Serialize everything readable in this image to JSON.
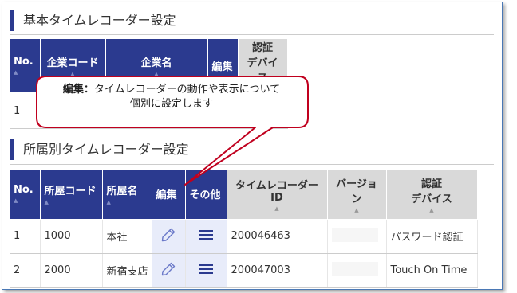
{
  "basic": {
    "title": "基本タイムレコーダー設定",
    "headers": {
      "no": "No.",
      "company_code": "企業コード",
      "company_name": "企業名",
      "edit": "編集",
      "auth_device_1": "認証",
      "auth_device_2": "デバイス"
    },
    "rows": [
      {
        "no": "1"
      }
    ]
  },
  "callout": {
    "label": "編集：",
    "text_1": "タイムレコーダーの動作や表示について",
    "text_2": "個別に設定します"
  },
  "dept": {
    "title": "所属別タイムレコーダー設定",
    "headers": {
      "no": "No.",
      "dept_code": "所屋コード",
      "dept_name": "所屋名",
      "edit": "編集",
      "other": "その他",
      "recorder_id": "タイムレコーダーID",
      "version": "バージョン",
      "auth_device_1": "認証",
      "auth_device_2": "デバイス"
    },
    "rows": [
      {
        "no": "1",
        "code": "1000",
        "name": "本社",
        "recorder_id": "200046463",
        "auth": "パスワード認証"
      },
      {
        "no": "2",
        "code": "2000",
        "name": "新宿支店",
        "recorder_id": "200047003",
        "auth": "Touch On Time"
      }
    ]
  },
  "icons": {
    "edit": "pencil-icon",
    "other": "hamburger-menu-icon",
    "sort": "sort-arrow-icon"
  },
  "colors": {
    "header_bg": "#2b3a8f",
    "header_gray": "#d9d9d9",
    "edit_cell_bg": "#e8ecfa",
    "callout_border": "#c0001e"
  }
}
